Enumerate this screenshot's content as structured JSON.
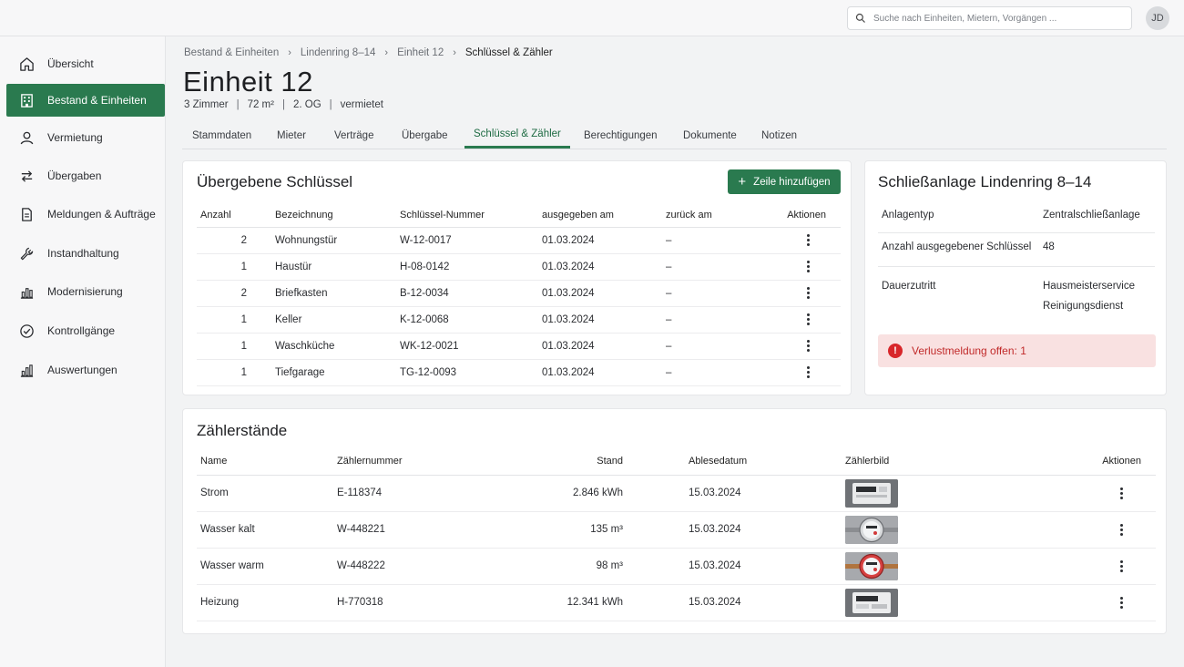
{
  "topbar": {
    "search_placeholder": "Suche nach Einheiten, Mietern, Vorgängen ...",
    "avatar_initials": "JD"
  },
  "sidebar": {
    "items": [
      {
        "label": "Übersicht",
        "icon": "home-icon",
        "active": false
      },
      {
        "label": "Bestand & Einheiten",
        "icon": "building-icon",
        "active": true
      },
      {
        "label": "Vermietung",
        "icon": "person-icon",
        "active": false
      },
      {
        "label": "Übergaben",
        "icon": "swap-icon",
        "active": false
      },
      {
        "label": "Meldungen & Aufträge",
        "icon": "document-icon",
        "active": false
      },
      {
        "label": "Instandhaltung",
        "icon": "wrench-icon",
        "active": false
      },
      {
        "label": "Modernisierung",
        "icon": "bar-chart-icon",
        "active": false
      },
      {
        "label": "Kontrollgänge",
        "icon": "check-circle-icon",
        "active": false
      },
      {
        "label": "Auswertungen",
        "icon": "bar-chart-icon",
        "active": false
      }
    ]
  },
  "breadcrumb": [
    "Bestand & Einheiten",
    "Lindenring 8–14",
    "Einheit 12",
    "Schlüssel & Zähler"
  ],
  "header": {
    "title": "Einheit 12",
    "meta": [
      "3 Zimmer",
      "72 m²",
      "2. OG",
      "vermietet"
    ]
  },
  "tabs": [
    "Stammdaten",
    "Mieter",
    "Verträge",
    "Übergabe",
    "Schlüssel & Zähler",
    "Berechtigungen",
    "Dokumente",
    "Notizen"
  ],
  "active_tab": "Schlüssel & Zähler",
  "keys": {
    "title": "Übergebene Schlüssel",
    "add_label": "Zeile hinzufügen",
    "columns": [
      "Anzahl",
      "Bezeichnung",
      "Schlüssel-Nummer",
      "ausgegeben am",
      "zurück am",
      "Aktionen"
    ],
    "rows": [
      [
        "2",
        "Wohnungstür",
        "W-12-0017",
        "01.03.2024",
        "–"
      ],
      [
        "1",
        "Haustür",
        "H-08-0142",
        "01.03.2024",
        "–"
      ],
      [
        "2",
        "Briefkasten",
        "B-12-0034",
        "01.03.2024",
        "–"
      ],
      [
        "1",
        "Keller",
        "K-12-0068",
        "01.03.2024",
        "–"
      ],
      [
        "1",
        "Waschküche",
        "WK-12-0021",
        "01.03.2024",
        "–"
      ],
      [
        "1",
        "Tiefgarage",
        "TG-12-0093",
        "01.03.2024",
        "–"
      ]
    ]
  },
  "lock_system": {
    "title": "Schließanlage Lindenring 8–14",
    "type_label": "Anlagentyp",
    "type_value": "Zentralschließanlage",
    "count_label": "Anzahl ausgegebener Schlüssel",
    "count_value": "48",
    "access_label": "Dauerzutritt",
    "access_values": [
      "Hausmeisterservice",
      "Reinigungsdienst"
    ],
    "alert_text": "Verlustmeldung offen: 1",
    "alert_color": "#d8262a"
  },
  "meters": {
    "title": "Zählerstände",
    "columns": [
      "Name",
      "Zählernummer",
      "Stand",
      "Ablesedatum",
      "Zählerbild",
      "Aktionen"
    ],
    "rows": [
      [
        "Strom",
        "E-118374",
        "2.846 kWh",
        "15.03.2024",
        "electric-meter"
      ],
      [
        "Wasser kalt",
        "W-448221",
        "135 m³",
        "15.03.2024",
        "water-meter-cold"
      ],
      [
        "Wasser warm",
        "W-448222",
        "98 m³",
        "15.03.2024",
        "water-meter-warm"
      ],
      [
        "Heizung",
        "H-770318",
        "12.341 kWh",
        "15.03.2024",
        "heating-meter"
      ]
    ]
  },
  "colors": {
    "accent": "#2a7a4f",
    "alert_bg": "#f9e1e1",
    "alert_text": "#c12a2a"
  }
}
